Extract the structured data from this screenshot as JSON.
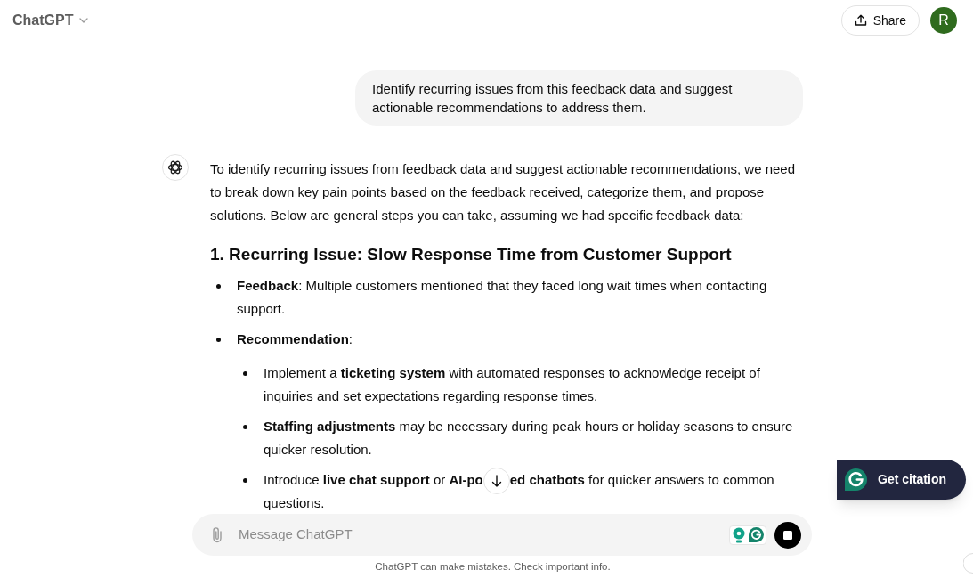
{
  "header": {
    "title": "ChatGPT",
    "share_label": "Share",
    "avatar_initial": "R"
  },
  "user_message": "Identify recurring issues from this feedback data and suggest actionable recommendations to address them.",
  "assistant": {
    "blocks": [
      {
        "kind": "paragraph",
        "text": "To identify recurring issues from feedback data and suggest actionable recommendations, we need to break down key pain points based on the feedback received, categorize them, and propose solutions. Below are general steps you can take, assuming we had specific feedback data:"
      },
      {
        "kind": "heading",
        "text": "1. Recurring Issue: Slow Response Time from Customer Support"
      },
      {
        "kind": "list",
        "items": [
          {
            "text": "**Feedback**: Multiple customers mentioned that they faced long wait times when contacting support."
          },
          {
            "text": "**Recommendation**:",
            "children": [
              {
                "text": "Implement a **ticketing system** with automated responses to acknowledge receipt of inquiries and set expectations regarding response times."
              },
              {
                "text": "**Staffing adjustments** may be necessary during peak hours or holiday seasons to ensure quicker resolution."
              },
              {
                "lines": [
                  [
                    "Introduce **live chat support** or **AI-po**",
                    "**ed chatbots** for quicker answers to common"
                  ],
                  [
                    "questions."
                  ]
                ]
              }
            ]
          }
        ]
      }
    ]
  },
  "composer": {
    "placeholder": "Message ChatGPT"
  },
  "footer": "ChatGPT can make mistakes. Check important info.",
  "citation_button": {
    "label": "Get citation"
  }
}
